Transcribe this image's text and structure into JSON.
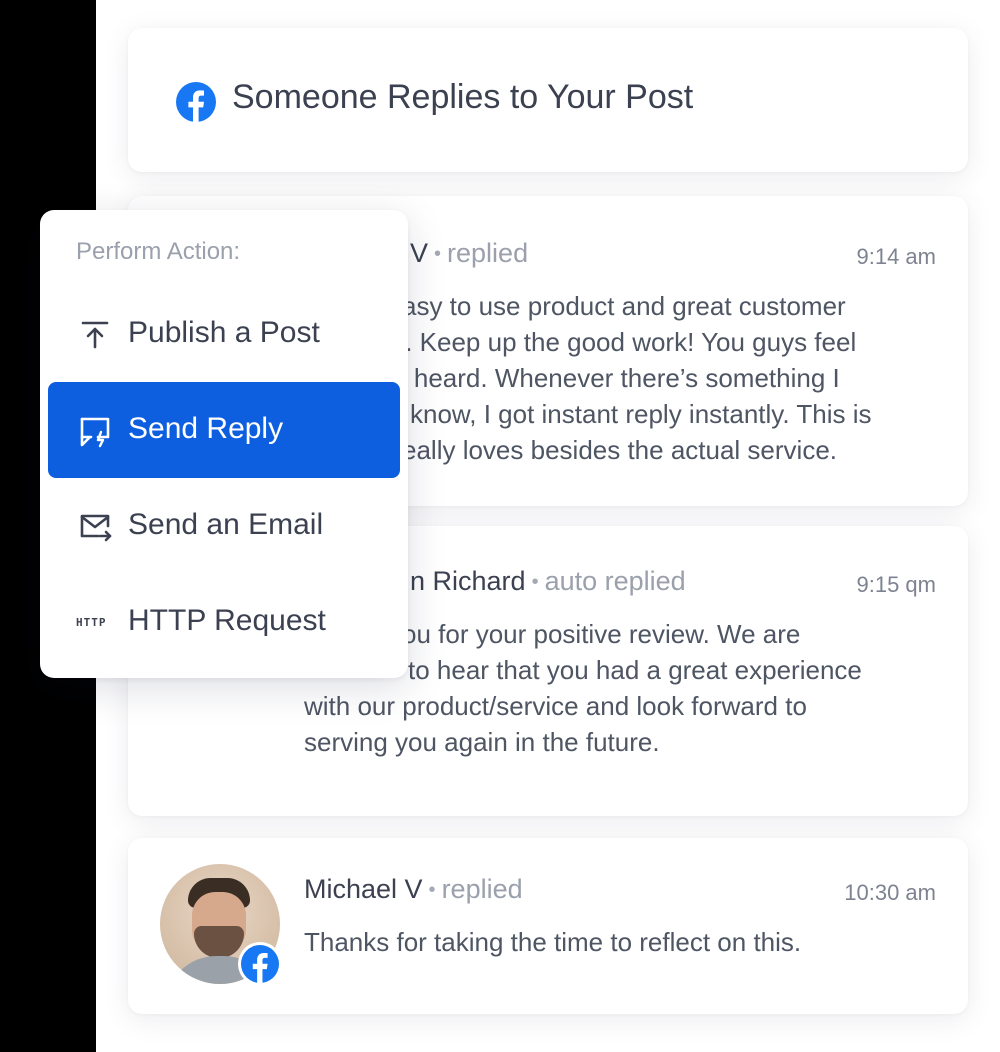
{
  "header": {
    "title": "Someone Replies to Your Post",
    "icon": "facebook-icon",
    "brand_color": "#1877F2"
  },
  "messages": [
    {
      "name": "V",
      "action": "replied",
      "time": "9:14 am",
      "lines": [
        "asy to use product and great customer",
        "t. Keep up the good work! You guys feel",
        "r heard. Whenever there’s something I",
        "know, I got instant reply instantly. This is",
        "eally loves besides the actual service."
      ]
    },
    {
      "name": "n Richard",
      "action": "auto replied",
      "time": "9:15 qm",
      "lines": [
        "ou for your positive review. We are",
        "to hear that you had a great experience",
        "with our product/service and look forward to",
        "serving you again in the future."
      ]
    },
    {
      "name": "Michael V",
      "action": "replied",
      "time": "10:30 am",
      "lines": [
        "Thanks for taking the time to reflect on this."
      ]
    }
  ],
  "menu": {
    "title": "Perform Action:",
    "items": [
      {
        "label": "Publish a Post",
        "icon": "upload-icon",
        "active": false
      },
      {
        "label": "Send Reply",
        "icon": "reply-icon",
        "active": true
      },
      {
        "label": "Send an Email",
        "icon": "email-send-icon",
        "active": false
      },
      {
        "label": "HTTP Request",
        "icon": "http-icon",
        "icon_text": "HTTP",
        "active": false
      }
    ],
    "accent": "#0E5FE0"
  },
  "separator": "•"
}
